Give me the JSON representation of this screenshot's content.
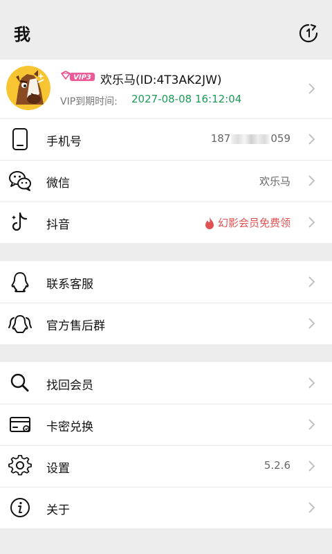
{
  "header": {
    "title": "我",
    "refresh_icon": "refresh-icon"
  },
  "profile": {
    "vip_badge": "VIP3",
    "nickname": "欢乐马(ID:4T3AK2JW)",
    "vip_expire_label": "VIP到期时间:",
    "vip_expire_date": "2027-08-08 16:12:04",
    "accent_color": "#1a9a55"
  },
  "account": {
    "phone": {
      "label": "手机号",
      "value_prefix": "187",
      "value_suffix": "059",
      "icon": "phone-icon"
    },
    "wechat": {
      "label": "微信",
      "value": "欢乐马",
      "icon": "wechat-icon"
    },
    "douyin": {
      "label": "抖音",
      "value": "幻影会员免费领",
      "icon": "douyin-icon",
      "value_color": "#e25252"
    }
  },
  "support": {
    "service": {
      "label": "联系客服",
      "icon": "qq-icon"
    },
    "group": {
      "label": "官方售后群",
      "icon": "qq-group-icon"
    }
  },
  "tools": {
    "recover": {
      "label": "找回会员",
      "icon": "search-icon"
    },
    "redeem": {
      "label": "卡密兑换",
      "icon": "card-icon"
    },
    "settings": {
      "label": "设置",
      "value": "5.2.6",
      "icon": "gear-icon"
    },
    "about": {
      "label": "关于",
      "icon": "info-icon"
    }
  }
}
